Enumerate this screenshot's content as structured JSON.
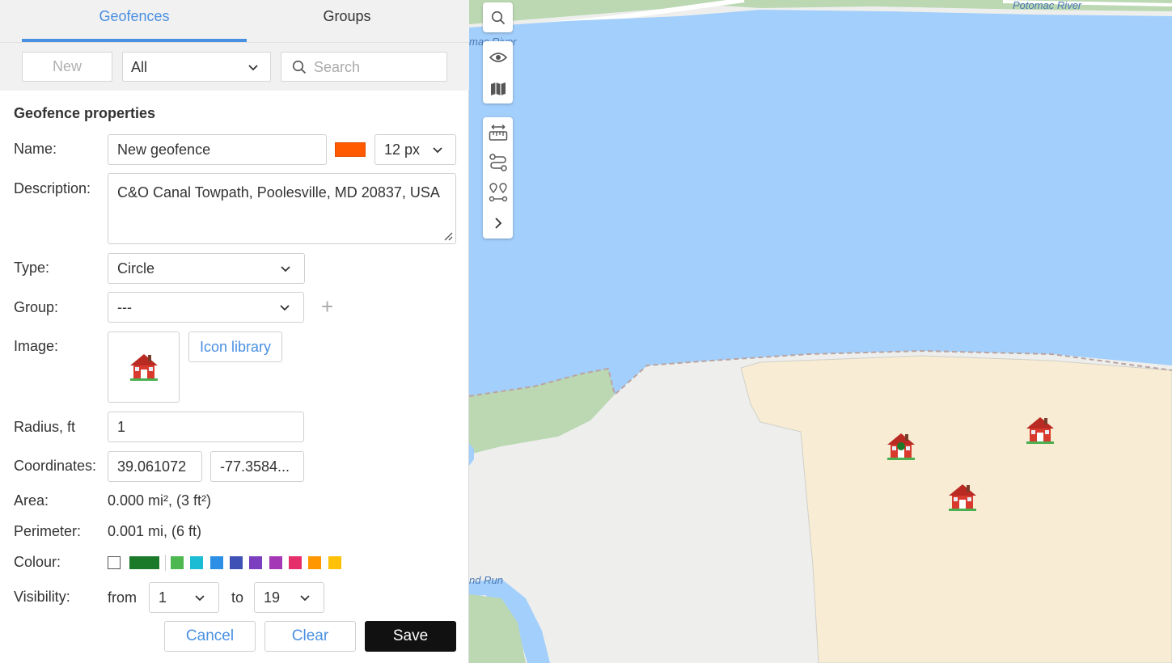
{
  "tabs": {
    "geofences": "Geofences",
    "groups": "Groups"
  },
  "toolbar": {
    "new_label": "New",
    "filter_value": "All",
    "search_placeholder": "Search"
  },
  "form": {
    "section_title": "Geofence properties",
    "name_label": "Name:",
    "name_value": "New geofence",
    "line_width": "12 px",
    "main_color": "#ff5a00",
    "description_label": "Description:",
    "description_value": "C&O Canal Towpath, Poolesville, MD 20837, USA",
    "type_label": "Type:",
    "type_value": "Circle",
    "group_label": "Group:",
    "group_value": "---",
    "image_label": "Image:",
    "image_icon": "house-icon",
    "icon_library_label": "Icon library",
    "radius_label": "Radius, ft",
    "radius_value": "1",
    "coordinates_label": "Coordinates:",
    "latitude": "39.061072",
    "longitude": "-77.3584...",
    "area_label": "Area:",
    "area_value": "0.000 mi², (3 ft²)",
    "perimeter_label": "Perimeter:",
    "perimeter_value": "0.001 mi, (6 ft)",
    "colour_label": "Colour:",
    "colour_palette": [
      "#ffffff",
      "#1b7a2a",
      "#4cb84f",
      "#1bbcd4",
      "#2d8ee6",
      "#3f51b5",
      "#7b3fbf",
      "#a337b5",
      "#e62e6b",
      "#ff9800",
      "#ffc107"
    ],
    "visibility_label": "Visibility:",
    "from_label": "from",
    "from_value": "1",
    "to_label": "to",
    "to_value": "19",
    "cancel_label": "Cancel",
    "clear_label": "Clear",
    "save_label": "Save"
  },
  "map": {
    "labels": {
      "river_top": "Potomac River",
      "river_left": "mac River",
      "run": "nd Run"
    },
    "colors": {
      "water": "#a3cffc",
      "park": "#bbd8b3",
      "land": "#eeefed",
      "zone": "#f8ecd4"
    },
    "controls": [
      "search-icon",
      "eye-icon",
      "map-icon",
      "ruler-icon",
      "route-icon",
      "waypoints-icon",
      "chevron-right-icon"
    ]
  }
}
